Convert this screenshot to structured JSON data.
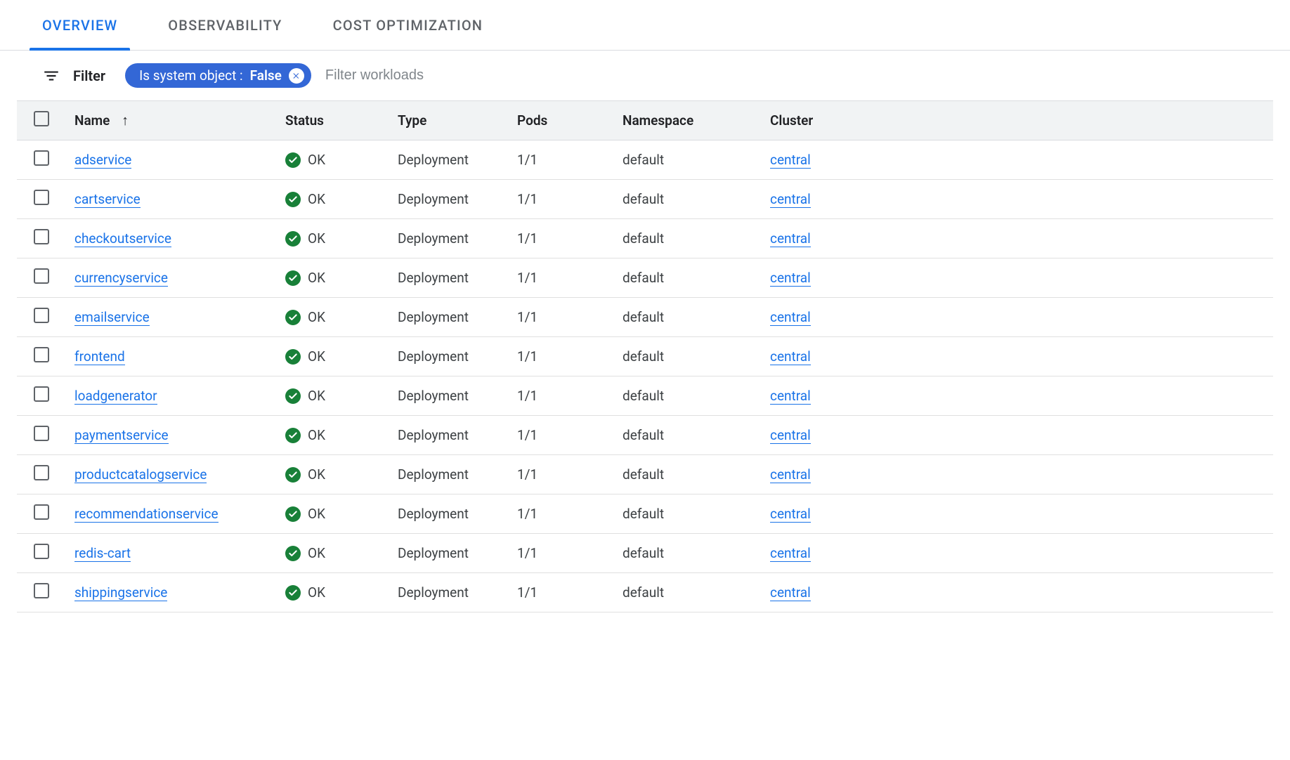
{
  "tabs": [
    {
      "label": "OVERVIEW",
      "active": true
    },
    {
      "label": "OBSERVABILITY",
      "active": false
    },
    {
      "label": "COST OPTIMIZATION",
      "active": false
    }
  ],
  "filter": {
    "label": "Filter",
    "chip_key": "Is system object : ",
    "chip_value": "False",
    "placeholder": "Filter workloads"
  },
  "columns": {
    "name": "Name",
    "status": "Status",
    "type": "Type",
    "pods": "Pods",
    "namespace": "Namespace",
    "cluster": "Cluster"
  },
  "status_ok": "OK",
  "rows": [
    {
      "name": "adservice",
      "status": "OK",
      "type": "Deployment",
      "pods": "1/1",
      "namespace": "default",
      "cluster": "central"
    },
    {
      "name": "cartservice",
      "status": "OK",
      "type": "Deployment",
      "pods": "1/1",
      "namespace": "default",
      "cluster": "central"
    },
    {
      "name": "checkoutservice",
      "status": "OK",
      "type": "Deployment",
      "pods": "1/1",
      "namespace": "default",
      "cluster": "central"
    },
    {
      "name": "currencyservice",
      "status": "OK",
      "type": "Deployment",
      "pods": "1/1",
      "namespace": "default",
      "cluster": "central"
    },
    {
      "name": "emailservice",
      "status": "OK",
      "type": "Deployment",
      "pods": "1/1",
      "namespace": "default",
      "cluster": "central"
    },
    {
      "name": "frontend",
      "status": "OK",
      "type": "Deployment",
      "pods": "1/1",
      "namespace": "default",
      "cluster": "central"
    },
    {
      "name": "loadgenerator",
      "status": "OK",
      "type": "Deployment",
      "pods": "1/1",
      "namespace": "default",
      "cluster": "central"
    },
    {
      "name": "paymentservice",
      "status": "OK",
      "type": "Deployment",
      "pods": "1/1",
      "namespace": "default",
      "cluster": "central"
    },
    {
      "name": "productcatalogservice",
      "status": "OK",
      "type": "Deployment",
      "pods": "1/1",
      "namespace": "default",
      "cluster": "central"
    },
    {
      "name": "recommendationservice",
      "status": "OK",
      "type": "Deployment",
      "pods": "1/1",
      "namespace": "default",
      "cluster": "central"
    },
    {
      "name": "redis-cart",
      "status": "OK",
      "type": "Deployment",
      "pods": "1/1",
      "namespace": "default",
      "cluster": "central"
    },
    {
      "name": "shippingservice",
      "status": "OK",
      "type": "Deployment",
      "pods": "1/1",
      "namespace": "default",
      "cluster": "central"
    }
  ]
}
